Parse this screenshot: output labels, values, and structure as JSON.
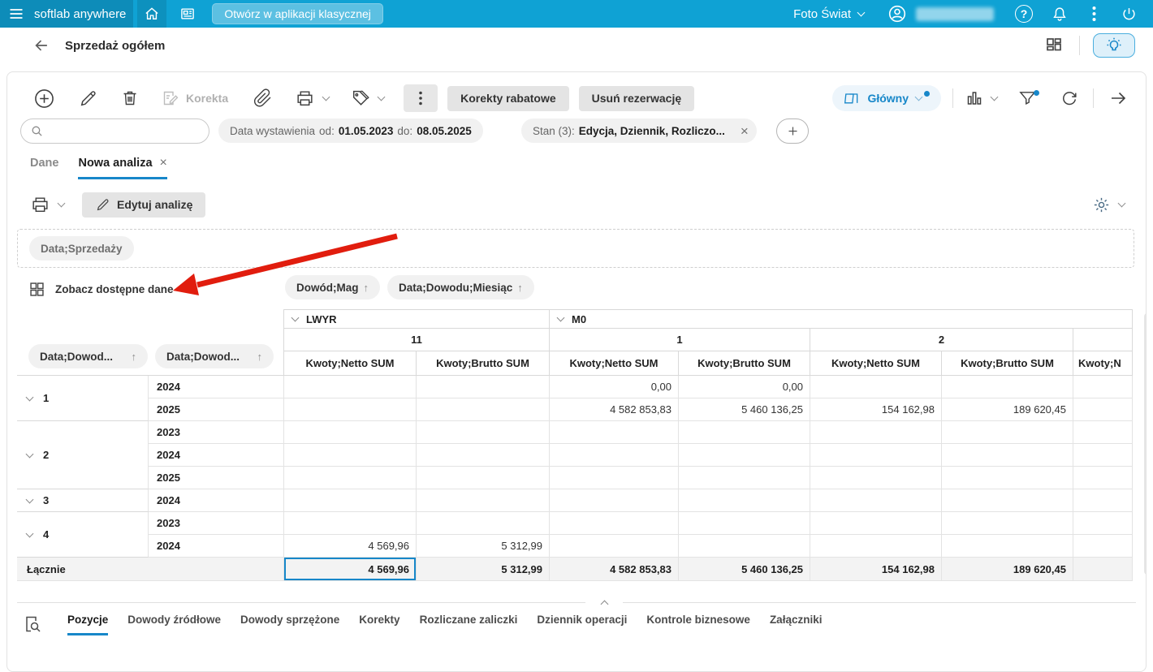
{
  "colors": {
    "accent": "#1787c9",
    "topbar": "#0fa2d4",
    "arrow_red": "#e11d0e"
  },
  "icons": {
    "sort_asc": "↑",
    "close": "×",
    "question": "?"
  },
  "topbar": {
    "brand": "softlab anywhere",
    "open_classic": "Otwórz w aplikacji klasycznej",
    "company": "Foto Świat"
  },
  "header": {
    "title": "Sprzedaż ogółem"
  },
  "toolbar": {
    "korekta": "Korekta",
    "korekty_rabatowe": "Korekty rabatowe",
    "usun_rezerwacje": "Usuń rezerwację",
    "glowny": "Główny"
  },
  "filters": {
    "date_label": "Data wystawienia",
    "od": "od:",
    "od_value": "01.05.2023",
    "do": "do:",
    "do_value": "08.05.2025",
    "stan_label": "Stan (3):",
    "stan_value": "Edycja, Dziennik, Rozliczo..."
  },
  "tabs": {
    "dane": "Dane",
    "nowa": "Nowa analiza"
  },
  "analysis": {
    "edit": "Edytuj analizę",
    "filter_chip": "Data;Sprzedaży",
    "available": "Zobacz dostępne dane",
    "col_field_1": "Dowód;Mag",
    "col_field_2": "Data;Dowodu;Miesiąc",
    "row_field_1": "Data;Dowod...",
    "row_field_2": "Data;Dowod..."
  },
  "pivot": {
    "group1": "LWYR",
    "group2": "M0",
    "month11": "11",
    "month1": "1",
    "month2": "2",
    "netto": "Kwoty;Netto SUM",
    "brutto": "Kwoty;Brutto SUM",
    "partial_measure": "Kwoty;N",
    "rows": [
      {
        "group": "1",
        "year": "2024",
        "c3": "0,00",
        "c4": "0,00"
      },
      {
        "year": "2025",
        "c3": "4 582 853,83",
        "c4": "5 460 136,25",
        "c5": "154 162,98",
        "c6": "189 620,45"
      },
      {
        "group": "2",
        "year": "2023"
      },
      {
        "year": "2024"
      },
      {
        "year": "2025"
      },
      {
        "group": "3",
        "year": "2024"
      },
      {
        "group": "4",
        "year": "2023"
      },
      {
        "year": "2024",
        "c1": "4 569,96",
        "c2": "5 312,99"
      }
    ],
    "total": {
      "label": "Łącznie",
      "c1": "4 569,96",
      "c2": "5 312,99",
      "c3": "4 582 853,83",
      "c4": "5 460 136,25",
      "c5": "154 162,98",
      "c6": "189 620,45"
    }
  },
  "bottom_tabs": [
    "Pozycje",
    "Dowody źródłowe",
    "Dowody sprzężone",
    "Korekty",
    "Rozliczane zaliczki",
    "Dziennik operacji",
    "Kontrole biznesowe",
    "Załączniki"
  ]
}
